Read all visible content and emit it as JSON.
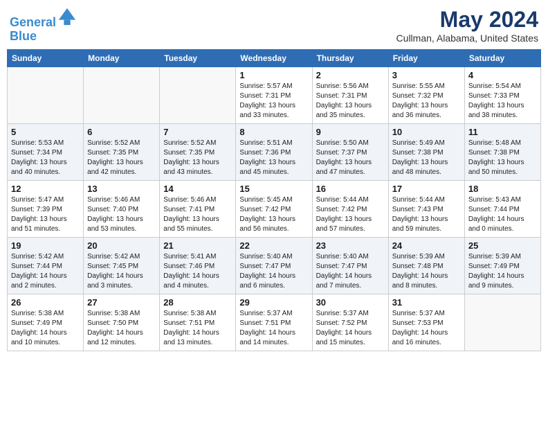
{
  "header": {
    "logo_line1": "General",
    "logo_line2": "Blue",
    "month_title": "May 2024",
    "location": "Cullman, Alabama, United States"
  },
  "days_of_week": [
    "Sunday",
    "Monday",
    "Tuesday",
    "Wednesday",
    "Thursday",
    "Friday",
    "Saturday"
  ],
  "weeks": [
    [
      {
        "day": "",
        "detail": ""
      },
      {
        "day": "",
        "detail": ""
      },
      {
        "day": "",
        "detail": ""
      },
      {
        "day": "1",
        "detail": "Sunrise: 5:57 AM\nSunset: 7:31 PM\nDaylight: 13 hours\nand 33 minutes."
      },
      {
        "day": "2",
        "detail": "Sunrise: 5:56 AM\nSunset: 7:31 PM\nDaylight: 13 hours\nand 35 minutes."
      },
      {
        "day": "3",
        "detail": "Sunrise: 5:55 AM\nSunset: 7:32 PM\nDaylight: 13 hours\nand 36 minutes."
      },
      {
        "day": "4",
        "detail": "Sunrise: 5:54 AM\nSunset: 7:33 PM\nDaylight: 13 hours\nand 38 minutes."
      }
    ],
    [
      {
        "day": "5",
        "detail": "Sunrise: 5:53 AM\nSunset: 7:34 PM\nDaylight: 13 hours\nand 40 minutes."
      },
      {
        "day": "6",
        "detail": "Sunrise: 5:52 AM\nSunset: 7:35 PM\nDaylight: 13 hours\nand 42 minutes."
      },
      {
        "day": "7",
        "detail": "Sunrise: 5:52 AM\nSunset: 7:35 PM\nDaylight: 13 hours\nand 43 minutes."
      },
      {
        "day": "8",
        "detail": "Sunrise: 5:51 AM\nSunset: 7:36 PM\nDaylight: 13 hours\nand 45 minutes."
      },
      {
        "day": "9",
        "detail": "Sunrise: 5:50 AM\nSunset: 7:37 PM\nDaylight: 13 hours\nand 47 minutes."
      },
      {
        "day": "10",
        "detail": "Sunrise: 5:49 AM\nSunset: 7:38 PM\nDaylight: 13 hours\nand 48 minutes."
      },
      {
        "day": "11",
        "detail": "Sunrise: 5:48 AM\nSunset: 7:38 PM\nDaylight: 13 hours\nand 50 minutes."
      }
    ],
    [
      {
        "day": "12",
        "detail": "Sunrise: 5:47 AM\nSunset: 7:39 PM\nDaylight: 13 hours\nand 51 minutes."
      },
      {
        "day": "13",
        "detail": "Sunrise: 5:46 AM\nSunset: 7:40 PM\nDaylight: 13 hours\nand 53 minutes."
      },
      {
        "day": "14",
        "detail": "Sunrise: 5:46 AM\nSunset: 7:41 PM\nDaylight: 13 hours\nand 55 minutes."
      },
      {
        "day": "15",
        "detail": "Sunrise: 5:45 AM\nSunset: 7:42 PM\nDaylight: 13 hours\nand 56 minutes."
      },
      {
        "day": "16",
        "detail": "Sunrise: 5:44 AM\nSunset: 7:42 PM\nDaylight: 13 hours\nand 57 minutes."
      },
      {
        "day": "17",
        "detail": "Sunrise: 5:44 AM\nSunset: 7:43 PM\nDaylight: 13 hours\nand 59 minutes."
      },
      {
        "day": "18",
        "detail": "Sunrise: 5:43 AM\nSunset: 7:44 PM\nDaylight: 14 hours\nand 0 minutes."
      }
    ],
    [
      {
        "day": "19",
        "detail": "Sunrise: 5:42 AM\nSunset: 7:44 PM\nDaylight: 14 hours\nand 2 minutes."
      },
      {
        "day": "20",
        "detail": "Sunrise: 5:42 AM\nSunset: 7:45 PM\nDaylight: 14 hours\nand 3 minutes."
      },
      {
        "day": "21",
        "detail": "Sunrise: 5:41 AM\nSunset: 7:46 PM\nDaylight: 14 hours\nand 4 minutes."
      },
      {
        "day": "22",
        "detail": "Sunrise: 5:40 AM\nSunset: 7:47 PM\nDaylight: 14 hours\nand 6 minutes."
      },
      {
        "day": "23",
        "detail": "Sunrise: 5:40 AM\nSunset: 7:47 PM\nDaylight: 14 hours\nand 7 minutes."
      },
      {
        "day": "24",
        "detail": "Sunrise: 5:39 AM\nSunset: 7:48 PM\nDaylight: 14 hours\nand 8 minutes."
      },
      {
        "day": "25",
        "detail": "Sunrise: 5:39 AM\nSunset: 7:49 PM\nDaylight: 14 hours\nand 9 minutes."
      }
    ],
    [
      {
        "day": "26",
        "detail": "Sunrise: 5:38 AM\nSunset: 7:49 PM\nDaylight: 14 hours\nand 10 minutes."
      },
      {
        "day": "27",
        "detail": "Sunrise: 5:38 AM\nSunset: 7:50 PM\nDaylight: 14 hours\nand 12 minutes."
      },
      {
        "day": "28",
        "detail": "Sunrise: 5:38 AM\nSunset: 7:51 PM\nDaylight: 14 hours\nand 13 minutes."
      },
      {
        "day": "29",
        "detail": "Sunrise: 5:37 AM\nSunset: 7:51 PM\nDaylight: 14 hours\nand 14 minutes."
      },
      {
        "day": "30",
        "detail": "Sunrise: 5:37 AM\nSunset: 7:52 PM\nDaylight: 14 hours\nand 15 minutes."
      },
      {
        "day": "31",
        "detail": "Sunrise: 5:37 AM\nSunset: 7:53 PM\nDaylight: 14 hours\nand 16 minutes."
      },
      {
        "day": "",
        "detail": ""
      }
    ]
  ]
}
